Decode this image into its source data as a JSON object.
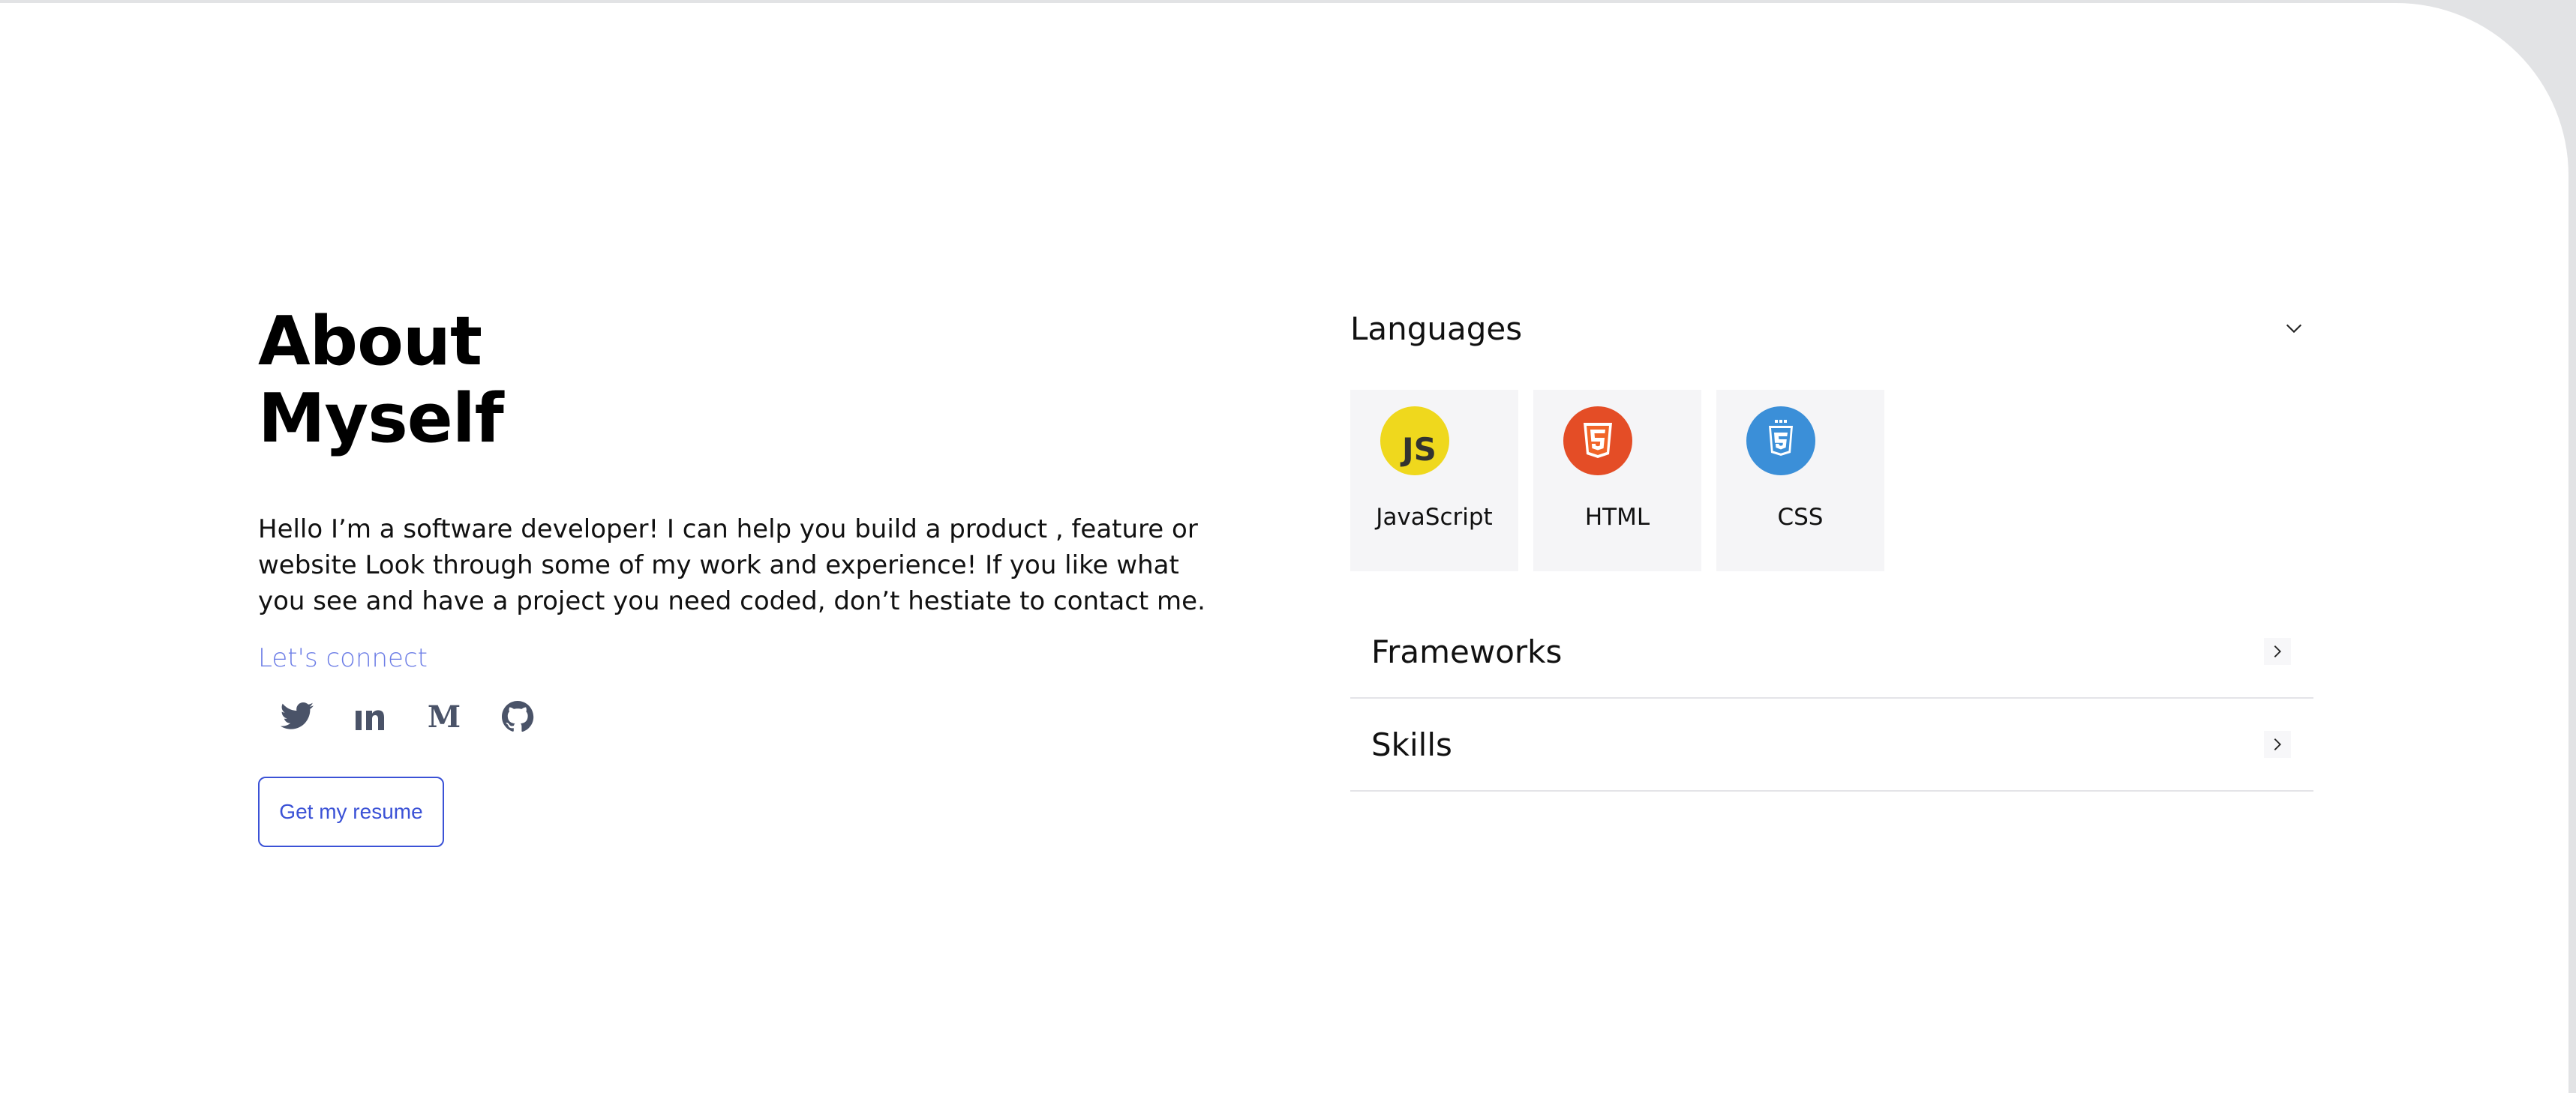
{
  "about": {
    "title_line1": "About",
    "title_line2": "Myself",
    "bio": "Hello I’m a software developer! I can help you build a product , feature or website Look through some of my work and experience! If you like what you see and have a project you need coded, don’t hestiate to contact me.",
    "connect_label": "Let's connect",
    "socials": [
      {
        "name": "twitter",
        "icon": "twitter-icon"
      },
      {
        "name": "linkedin",
        "icon": "linkedin-icon"
      },
      {
        "name": "medium",
        "icon": "medium-icon"
      },
      {
        "name": "github",
        "icon": "github-icon"
      }
    ],
    "resume_button": "Get my resume"
  },
  "skills_panel": {
    "languages": {
      "title": "Languages",
      "expanded": true,
      "items": [
        {
          "label": "JavaScript",
          "icon": "javascript-icon"
        },
        {
          "label": "HTML",
          "icon": "html5-icon"
        },
        {
          "label": "CSS",
          "icon": "css3-icon"
        }
      ]
    },
    "sections": [
      {
        "title": "Frameworks",
        "expanded": false
      },
      {
        "title": "Skills",
        "expanded": false
      }
    ]
  },
  "colors": {
    "accent": "#3b52d6",
    "connect": "#6c7de6",
    "icon_gray": "#4a5368",
    "javascript": "#efd81d",
    "html": "#e44d26",
    "css": "#3b8fd8",
    "card_bg": "#f5f5f7"
  }
}
